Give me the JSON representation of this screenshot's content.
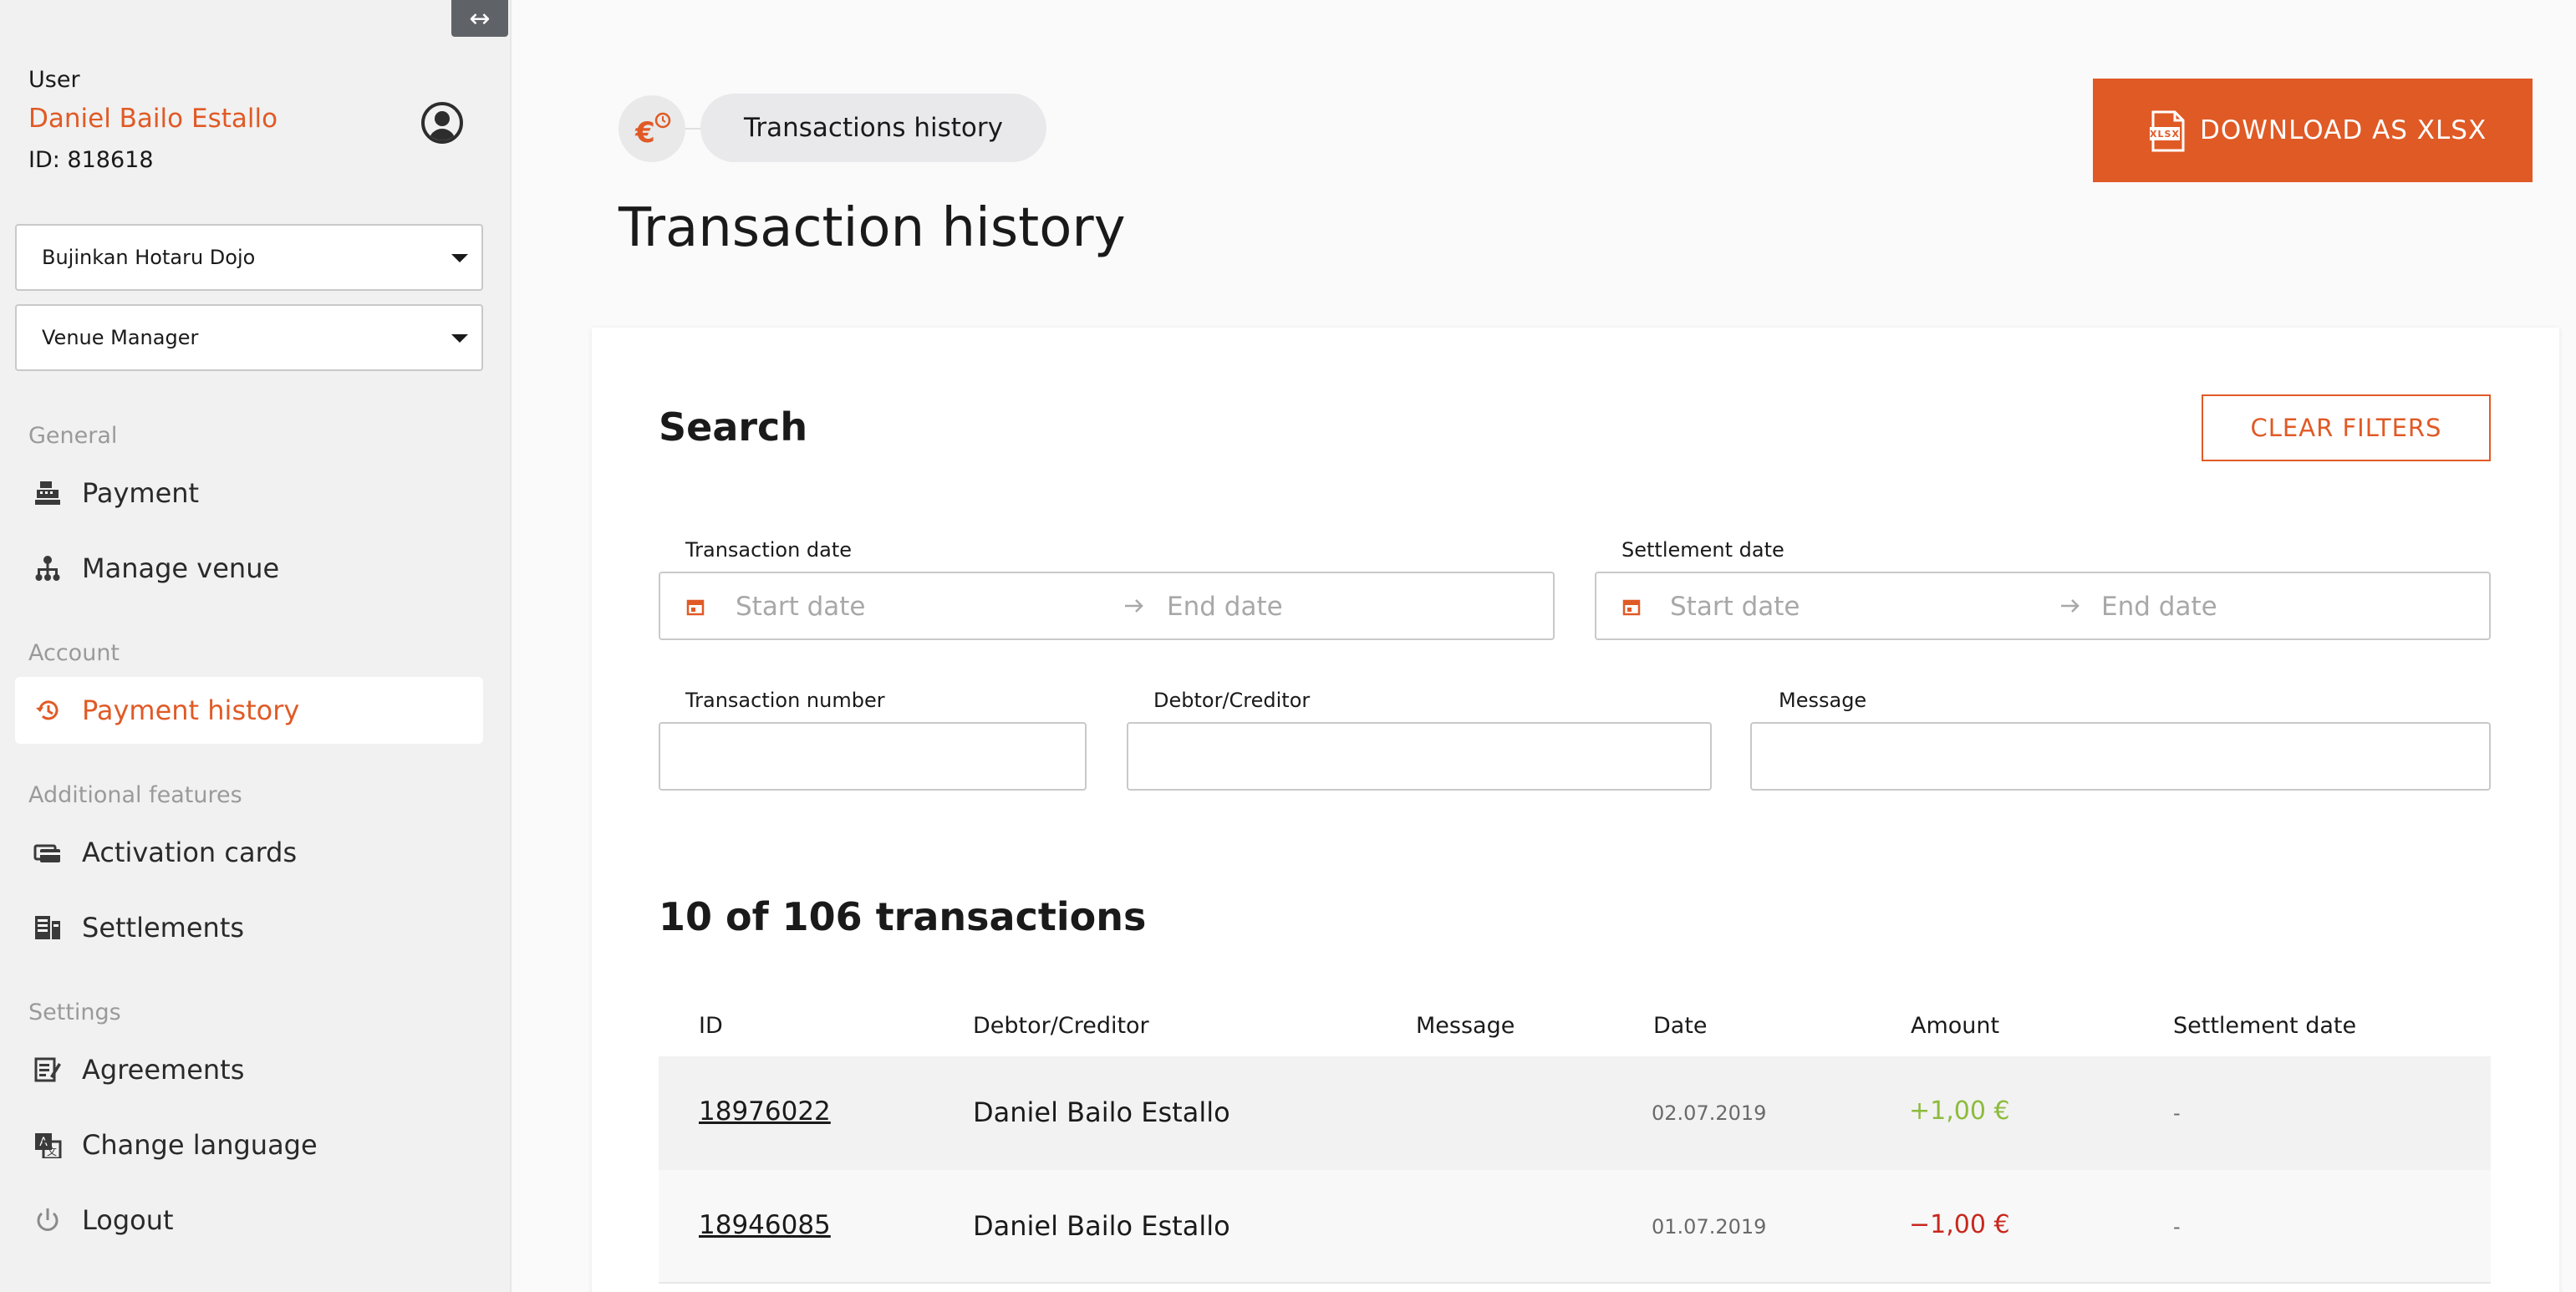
{
  "sidebar": {
    "collapse_icon": "↔",
    "user": {
      "caption": "User",
      "name": "Daniel Bailo Estallo",
      "id_text": "ID: 818618"
    },
    "venue_select": "Bujinkan Hotaru Dojo",
    "role_select": "Venue Manager",
    "sections": {
      "general": "General",
      "account": "Account",
      "additional": "Additional features",
      "settings": "Settings"
    },
    "items": {
      "payment": "Payment",
      "manage_venue": "Manage venue",
      "payment_history": "Payment history",
      "activation_cards": "Activation cards",
      "settlements": "Settlements",
      "agreements": "Agreements",
      "change_language": "Change language",
      "logout": "Logout"
    }
  },
  "header": {
    "breadcrumb": "Transactions history",
    "title": "Transaction history",
    "download_label": "DOWNLOAD AS XLSX"
  },
  "search": {
    "title": "Search",
    "clear_label": "CLEAR FILTERS",
    "transaction_date_label": "Transaction date",
    "settlement_date_label": "Settlement date",
    "start_placeholder": "Start date",
    "end_placeholder": "End date",
    "transaction_number_label": "Transaction number",
    "debtor_label": "Debtor/Creditor",
    "message_label": "Message"
  },
  "results": {
    "count_text": "10 of 106 transactions",
    "columns": [
      "ID",
      "Debtor/Creditor",
      "Message",
      "Date",
      "Amount",
      "Settlement date"
    ],
    "rows": [
      {
        "id": "18976022",
        "debtor": "Daniel Bailo Estallo",
        "message": "",
        "date": "02.07.2019",
        "amount": "+1,00 €",
        "settlement": "-"
      },
      {
        "id": "18946085",
        "debtor": "Daniel Bailo Estallo",
        "message": "",
        "date": "01.07.2019",
        "amount": "−1,00 €",
        "settlement": "-"
      }
    ]
  },
  "colors": {
    "accent": "#e05a26",
    "positive": "#8dbb3c",
    "negative": "#c8281e",
    "sidebar_bg": "#f1f1f1"
  }
}
